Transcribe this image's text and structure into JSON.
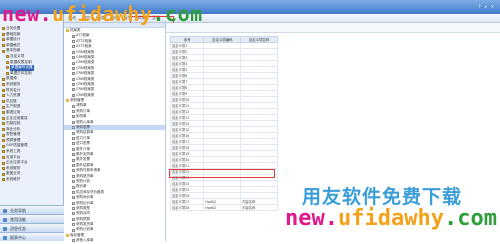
{
  "topbar": {
    "right_items": [
      "?",
      "▾",
      "✕"
    ]
  },
  "menubar": {
    "items": [
      "查询",
      "增加",
      "修改",
      "删除",
      "复制",
      "刷新",
      "显示"
    ]
  },
  "sidebar": {
    "items": [
      {
        "label": "业务设置",
        "indent": 0
      },
      {
        "label": "基础档案",
        "indent": 0
      },
      {
        "label": "单据设计",
        "indent": 0
      },
      {
        "label": "单据格式",
        "indent": 0
      },
      {
        "label": "基本档案",
        "indent": 0
      },
      {
        "label": "自定义项",
        "indent": 1
      },
      {
        "label": "数据权限控制",
        "indent": 1
      },
      {
        "label": "单据编号设置",
        "indent": 1
      },
      {
        "label": "单据打印控制",
        "indent": 1
      },
      {
        "label": "数据源",
        "indent": 0
      },
      {
        "label": "系统服务",
        "indent": 0
      },
      {
        "label": "财务会计",
        "indent": 0
      },
      {
        "label": "人力资源",
        "indent": 0
      },
      {
        "label": "供应链",
        "indent": 0
      },
      {
        "label": "生产制造",
        "indent": 0
      },
      {
        "label": "集团应用",
        "indent": 0
      },
      {
        "label": "企业应用集成",
        "indent": 0
      },
      {
        "label": "内部控制",
        "indent": 0
      },
      {
        "label": "商业分析",
        "indent": 0
      },
      {
        "label": "零售管理",
        "indent": 0
      },
      {
        "label": "预算管理",
        "indent": 0
      },
      {
        "label": "GSP质量管理",
        "indent": 0
      },
      {
        "label": "系统工具",
        "indent": 0
      },
      {
        "label": "应用平台",
        "indent": 0
      },
      {
        "label": "企业应用平台",
        "indent": 0
      },
      {
        "label": "系统服务",
        "indent": 0
      },
      {
        "label": "集团业务",
        "indent": 0
      },
      {
        "label": "系统维护",
        "indent": 0
      }
    ],
    "selected_index": 7,
    "bottom_buttons": [
      "业务导航",
      "常用功能",
      "消息任务",
      "报表中心"
    ]
  },
  "tree": {
    "items": [
      {
        "label": "档案类",
        "type": "folder"
      },
      {
        "label": "ATT档案",
        "type": "doc"
      },
      {
        "label": "ATT2档案",
        "type": "doc"
      },
      {
        "label": "ATT3档案",
        "type": "doc"
      },
      {
        "label": "CRM档案类",
        "type": "doc"
      },
      {
        "label": "CRM档案类",
        "type": "doc"
      },
      {
        "label": "CRM档案类",
        "type": "doc"
      },
      {
        "label": "CRM档案类",
        "type": "doc"
      },
      {
        "label": "CRM档案类",
        "type": "doc"
      },
      {
        "label": "CRM档案类",
        "type": "doc"
      },
      {
        "label": "CRM档案类",
        "type": "doc"
      },
      {
        "label": "CRM档案类",
        "type": "doc"
      },
      {
        "label": "CRM档案类",
        "type": "doc"
      },
      {
        "label": "采购管理",
        "type": "folder"
      },
      {
        "label": "请购单",
        "type": "doc"
      },
      {
        "label": "采购订单",
        "type": "doc"
      },
      {
        "label": "到货单",
        "type": "doc"
      },
      {
        "label": "采购入库单",
        "type": "doc"
      },
      {
        "label": "采购发票",
        "type": "doc"
      },
      {
        "label": "采购结算单",
        "type": "doc"
      },
      {
        "label": "进口订单",
        "type": "doc"
      },
      {
        "label": "进口发票",
        "type": "doc"
      },
      {
        "label": "委外订单",
        "type": "doc"
      },
      {
        "label": "委外到货单",
        "type": "doc"
      },
      {
        "label": "委外发票",
        "type": "doc"
      },
      {
        "label": "委外结算单",
        "type": "doc"
      },
      {
        "label": "采购付款申请单",
        "type": "doc"
      },
      {
        "label": "采购退货单",
        "type": "doc"
      },
      {
        "label": "采购计划",
        "type": "doc"
      },
      {
        "label": "报价单",
        "type": "doc"
      },
      {
        "label": "供应商存货价格表",
        "type": "doc"
      },
      {
        "label": "采购询价单",
        "type": "doc"
      },
      {
        "label": "采购比价单",
        "type": "doc"
      },
      {
        "label": "采购类型",
        "type": "doc"
      },
      {
        "label": "采购合同",
        "type": "doc"
      },
      {
        "label": "采购预算",
        "type": "doc"
      },
      {
        "label": "采购发货单",
        "type": "doc"
      },
      {
        "label": "采购计划单",
        "type": "doc"
      },
      {
        "label": "库存管理",
        "type": "folder"
      },
      {
        "label": "其他入库单",
        "type": "doc"
      }
    ],
    "highlight_index": 18
  },
  "grid": {
    "headers": [
      "序号",
      "自定义项编码",
      "自定义项名称"
    ],
    "rows": [
      [
        "自定义项1",
        "",
        ""
      ],
      [
        "自定义项2",
        "",
        ""
      ],
      [
        "自定义项3",
        "",
        ""
      ],
      [
        "自定义项4",
        "",
        ""
      ],
      [
        "自定义项5",
        "",
        ""
      ],
      [
        "自定义项6",
        "",
        ""
      ],
      [
        "自定义项7",
        "",
        ""
      ],
      [
        "自定义项8",
        "",
        ""
      ],
      [
        "自定义项9",
        "",
        ""
      ],
      [
        "自定义项10",
        "",
        ""
      ],
      [
        "自定义项11",
        "",
        ""
      ],
      [
        "自定义项12",
        "",
        ""
      ],
      [
        "自定义项13",
        "",
        ""
      ],
      [
        "自定义项14",
        "",
        ""
      ],
      [
        "自定义项15",
        "",
        ""
      ],
      [
        "自定义项16",
        "",
        ""
      ],
      [
        "自定义项17",
        "",
        ""
      ],
      [
        "自定义项18",
        "",
        ""
      ],
      [
        "自定义项19",
        "",
        ""
      ],
      [
        "自定义项20",
        "",
        ""
      ],
      [
        "自定义项21",
        "",
        ""
      ],
      [
        "自定义项22",
        "",
        ""
      ],
      [
        "自定义项23",
        "",
        ""
      ],
      [
        "自定义项24",
        "",
        ""
      ],
      [
        "自定义项25",
        "",
        ""
      ],
      [
        "自定义项26",
        "",
        ""
      ],
      [
        "自定义项27",
        "Hpd01",
        "内容名称"
      ],
      [
        "自定义项28",
        "Hpd02",
        "内容名称"
      ]
    ]
  },
  "watermark": {
    "top_a": "new.",
    "top_b": "ufidawhy",
    "top_c": ".com",
    "cn": "用友软件免费下载",
    "bottom_a": "new.",
    "bottom_b": "ufidawhy",
    "bottom_c": ".com"
  }
}
